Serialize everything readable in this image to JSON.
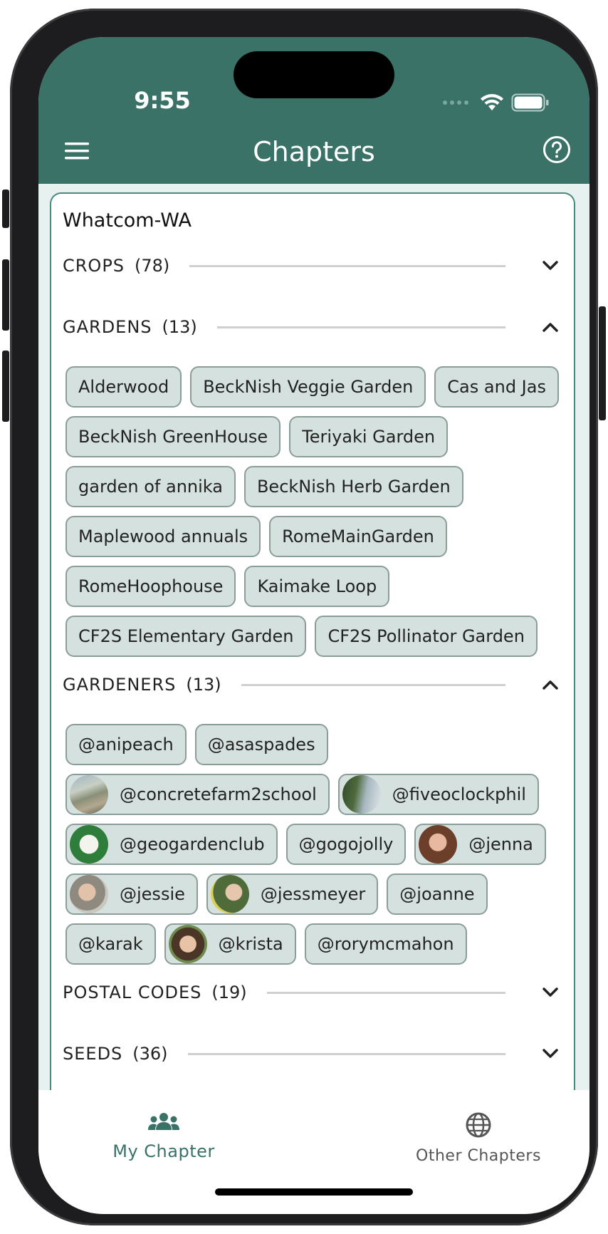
{
  "status_bar": {
    "time": "9:55"
  },
  "header": {
    "title": "Chapters",
    "menu_icon": "menu-icon",
    "help_icon": "help-icon"
  },
  "chapter": {
    "name": "Whatcom-WA"
  },
  "sections": {
    "crops": {
      "label": "CROPS",
      "count": "(78)",
      "expanded": false
    },
    "gardens": {
      "label": "GARDENS",
      "count": "(13)",
      "expanded": true,
      "items": [
        "Alderwood",
        "BeckNish Veggie Garden",
        "Cas and Jas",
        "BeckNish GreenHouse",
        "Teriyaki Garden",
        "garden of annika",
        "BeckNish Herb Garden",
        "Maplewood annuals",
        "RomeMainGarden",
        "RomeHoophouse",
        "Kaimake Loop",
        "CF2S Elementary Garden",
        "CF2S Pollinator Garden"
      ]
    },
    "gardeners": {
      "label": "GARDENERS",
      "count": "(13)",
      "expanded": true,
      "items": [
        "@anipeach",
        "@asaspades",
        "@concretefarm2school",
        "@fiveoclockphil",
        "@geogardenclub",
        "@gogojolly",
        "@jenna",
        "@jessie",
        "@jessmeyer",
        "@joanne",
        "@karak",
        "@krista",
        "@rorymcmahon"
      ]
    },
    "postal_codes": {
      "label": "POSTAL CODES",
      "count": "(19)",
      "expanded": false
    },
    "seeds": {
      "label": "SEEDS",
      "count": "(36)",
      "expanded": false
    }
  },
  "tabbar": {
    "tabs": [
      {
        "label": "My Chapter",
        "icon": "group-icon",
        "active": true
      },
      {
        "label": "Other Chapters",
        "icon": "globe-icon",
        "active": false
      }
    ]
  },
  "colors": {
    "header": "#3a7268",
    "accent": "#3a7268",
    "chip_bg": "#d5e1de",
    "card_border": "#4a8a7e"
  }
}
